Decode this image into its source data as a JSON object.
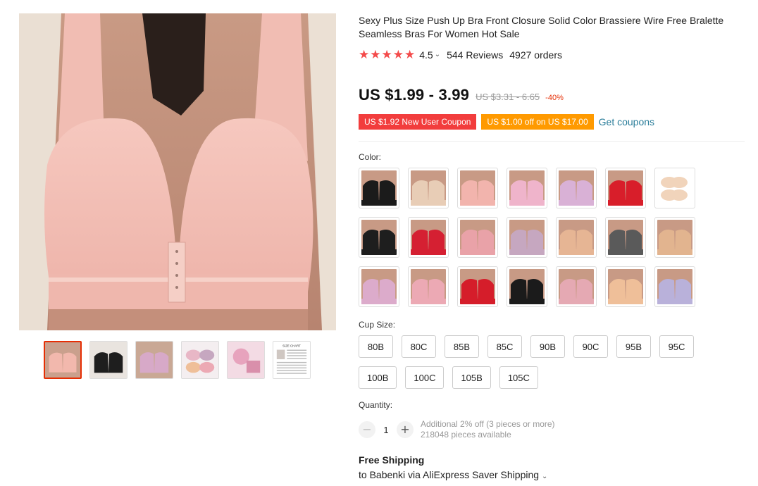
{
  "product": {
    "title": "Sexy Plus Size Push Up Bra Front Closure Solid Color Brassiere Wire Free Bralette Seamless Bras For Women Hot Sale",
    "rating": "4.5",
    "rating_value": 4.5,
    "reviews": "544 Reviews",
    "orders": "4927 orders",
    "price": "US $1.99 - 3.99",
    "original_price": "US $3.31 - 6.65",
    "discount": "-40%",
    "coupons": [
      {
        "label": "US $1.92 New User Coupon",
        "color": "#f23d3d"
      },
      {
        "label": "US $1.00 off on US $17.00",
        "color": "#ff9a00"
      }
    ],
    "get_coupons": "Get coupons"
  },
  "gallery": {
    "thumbnails": [
      {
        "name": "pink",
        "color": "#f2b8ad",
        "active": true
      },
      {
        "name": "black",
        "color": "#1e1e1e",
        "active": false
      },
      {
        "name": "lilac",
        "color": "#d7a9c8",
        "active": false
      },
      {
        "name": "set",
        "color": "#e8b7c6",
        "active": false
      },
      {
        "name": "detail",
        "color": "#e7a3bd",
        "active": false
      },
      {
        "name": "size-chart",
        "color": "#ffffff",
        "active": false
      }
    ],
    "size_chart_label": "SIZE CHART"
  },
  "color_section": {
    "label": "Color:",
    "swatches": [
      "#1b1b1b",
      "#e8cdb6",
      "#f2b4ad",
      "#efb4cb",
      "#d9b1d6",
      "#d81e2a",
      "#f1d4bb",
      "#1e1e1e",
      "#d52032",
      "#e9a2a8",
      "#c6a7c0",
      "#e6b594",
      "#5a5a5a",
      "#e2b48f",
      "#dcabcb",
      "#eca9b4",
      "#d51d2a",
      "#1b1b1b",
      "#e5a9b3",
      "#efbf99",
      "#b9b1da"
    ]
  },
  "cup_size": {
    "label": "Cup Size:",
    "options": [
      "80B",
      "80C",
      "85B",
      "85C",
      "90B",
      "90C",
      "95B",
      "95C",
      "100B",
      "100C",
      "105B",
      "105C"
    ]
  },
  "quantity": {
    "label": "Quantity:",
    "value": "1",
    "minus": "−",
    "plus": "+",
    "additional": "Additional 2% off (3 pieces or more)",
    "available": "218048 pieces available"
  },
  "shipping": {
    "title": "Free Shipping",
    "line": "to Babenki via AliExpress Saver Shipping"
  }
}
